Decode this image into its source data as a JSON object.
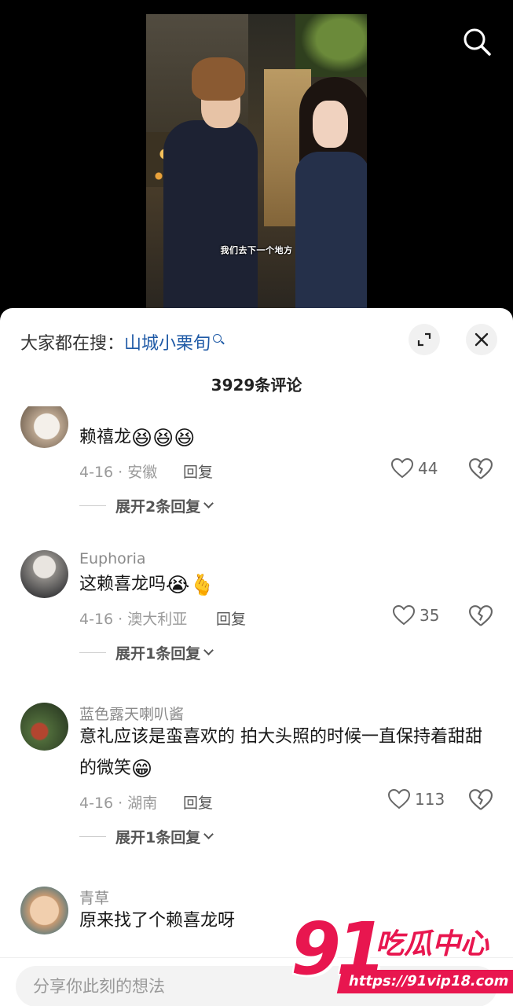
{
  "video": {
    "subtitle": "我们去下一个地方"
  },
  "header": {
    "hot_search_label": "大家都在搜：",
    "hot_search_term": "山城小栗旬",
    "comment_count": "3929条评论"
  },
  "comments": [
    {
      "username": "",
      "text": "赖禧龙",
      "emojis": "😆😆😆",
      "date_location": "4-16 · 安徽",
      "reply_label": "回复",
      "likes": "44",
      "expand_label": "展开2条回复"
    },
    {
      "username": "Euphoria",
      "text": "这赖喜龙吗",
      "emojis": "😭🫰",
      "date_location": "4-16 · 澳大利亚",
      "reply_label": "回复",
      "likes": "35",
      "expand_label": "展开1条回复"
    },
    {
      "username": "蓝色露天喇叭酱",
      "text": "意礼应该是蛮喜欢的 拍大头照的时候一直保持着甜甜的微笑",
      "emojis": "😁",
      "date_location": "4-16 · 湖南",
      "reply_label": "回复",
      "likes": "113",
      "expand_label": "展开1条回复"
    },
    {
      "username": "青草",
      "text": "原来找了个赖喜龙呀",
      "emojis": "",
      "date_location": "",
      "reply_label": "",
      "likes": "",
      "expand_label": ""
    }
  ],
  "input": {
    "placeholder": "分享你此刻的想法"
  },
  "watermark": {
    "number": "91",
    "text": "吃瓜中心",
    "url": "https://91vip18.com"
  },
  "colors": {
    "accent_link": "#1f5aa6",
    "watermark": "#e8164f"
  }
}
